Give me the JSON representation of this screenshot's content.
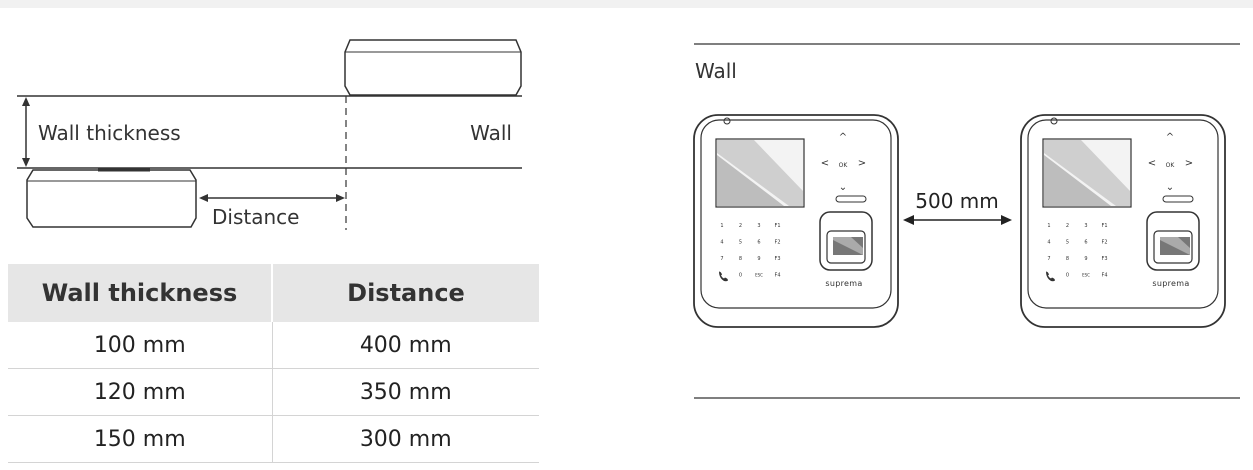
{
  "left_diagram": {
    "wall_thickness_label": "Wall thickness",
    "wall_label": "Wall",
    "distance_label": "Distance"
  },
  "table": {
    "headers": [
      "Wall thickness",
      "Distance"
    ],
    "rows": [
      [
        "100 mm",
        "400 mm"
      ],
      [
        "120 mm",
        "350 mm"
      ],
      [
        "150 mm",
        "300 mm"
      ]
    ]
  },
  "right_diagram": {
    "wall_label": "Wall",
    "distance_label": "500 mm",
    "brand": "suprema",
    "keypad": [
      "1",
      "2",
      "3",
      "F1",
      "4",
      "5",
      "6",
      "F2",
      "7",
      "8",
      "9",
      "F3",
      "",
      "0",
      "ESC",
      "F4"
    ],
    "ok_label": "OK"
  }
}
